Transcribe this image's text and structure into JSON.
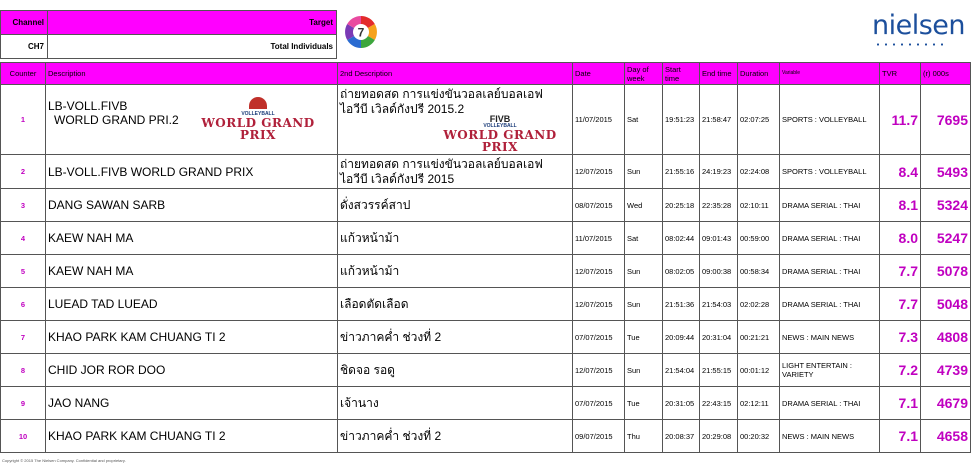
{
  "header": {
    "channel_label": "Channel",
    "target_label": "Target",
    "channel_value": "CH7",
    "target_value": "Total Individuals",
    "brand": "nielsen",
    "channel_logo": "7"
  },
  "columns": {
    "counter": "Counter",
    "description": "Description",
    "description2": "2nd Description",
    "date": "Date",
    "day": "Day of week",
    "start": "Start time",
    "end": "End time",
    "duration": "Duration",
    "variable": "Variable",
    "tvr": "TVR",
    "thousands": "(r) 000s"
  },
  "fivb_logo": {
    "brand": "FIVB",
    "sub": "VOLLEYBALL",
    "title": "WORLD GRAND PRIX"
  },
  "rows": [
    {
      "counter": "1",
      "desc": "LB-VOLL.FIVB",
      "desc_b": "WORLD GRAND PRI.2",
      "desc2": "ถ่ายทอดสด การแข่งขันวอลเลย์บอลเอฟ",
      "desc2_b": "ไอวีบี เวิลด์กังปรี 2015.2",
      "date": "11/07/2015",
      "day": "Sat",
      "start": "19:51:23",
      "end": "21:58:47",
      "duration": "02:07:25",
      "variable": "SPORTS : VOLLEYBALL",
      "tvr": "11.7",
      "thousands": "7695"
    },
    {
      "counter": "2",
      "desc": "LB-VOLL.FIVB WORLD GRAND PRIX",
      "desc_b": "",
      "desc2": "ถ่ายทอดสด การแข่งขันวอลเลย์บอลเอฟ",
      "desc2_b": "ไอวีบี เวิลด์กังปรี 2015",
      "date": "12/07/2015",
      "day": "Sun",
      "start": "21:55:16",
      "end": "24:19:23",
      "duration": "02:24:08",
      "variable": "SPORTS : VOLLEYBALL",
      "tvr": "8.4",
      "thousands": "5493"
    },
    {
      "counter": "3",
      "desc": "DANG SAWAN SARB",
      "desc_b": "",
      "desc2": "ดั่งสวรรค์สาป",
      "desc2_b": "",
      "date": "08/07/2015",
      "day": "Wed",
      "start": "20:25:18",
      "end": "22:35:28",
      "duration": "02:10:11",
      "variable": "DRAMA SERIAL : THAI",
      "tvr": "8.1",
      "thousands": "5324"
    },
    {
      "counter": "4",
      "desc": "KAEW NAH MA",
      "desc_b": "",
      "desc2": "แก้วหน้าม้า",
      "desc2_b": "",
      "date": "11/07/2015",
      "day": "Sat",
      "start": "08:02:44",
      "end": "09:01:43",
      "duration": "00:59:00",
      "variable": "DRAMA SERIAL : THAI",
      "tvr": "8.0",
      "thousands": "5247"
    },
    {
      "counter": "5",
      "desc": "KAEW NAH MA",
      "desc_b": "",
      "desc2": "แก้วหน้าม้า",
      "desc2_b": "",
      "date": "12/07/2015",
      "day": "Sun",
      "start": "08:02:05",
      "end": "09:00:38",
      "duration": "00:58:34",
      "variable": "DRAMA SERIAL : THAI",
      "tvr": "7.7",
      "thousands": "5078"
    },
    {
      "counter": "6",
      "desc": "LUEAD TAD LUEAD",
      "desc_b": "",
      "desc2": "เลือดตัดเลือด",
      "desc2_b": "",
      "date": "12/07/2015",
      "day": "Sun",
      "start": "21:51:36",
      "end": "21:54:03",
      "duration": "02:02:28",
      "variable": "DRAMA SERIAL : THAI",
      "tvr": "7.7",
      "thousands": "5048"
    },
    {
      "counter": "7",
      "desc": "KHAO PARK KAM CHUANG TI 2",
      "desc_b": "",
      "desc2": "ข่าวภาคค่ำ ช่วงที่ 2",
      "desc2_b": "",
      "date": "07/07/2015",
      "day": "Tue",
      "start": "20:09:44",
      "end": "20:31:04",
      "duration": "00:21:21",
      "variable": "NEWS : MAIN NEWS",
      "tvr": "7.3",
      "thousands": "4808"
    },
    {
      "counter": "8",
      "desc": "CHID JOR ROR DOO",
      "desc_b": "",
      "desc2": "ชิดจอ รอดู",
      "desc2_b": "",
      "date": "12/07/2015",
      "day": "Sun",
      "start": "21:54:04",
      "end": "21:55:15",
      "duration": "00:01:12",
      "variable": "LIGHT ENTERTAIN : VARIETY",
      "tvr": "7.2",
      "thousands": "4739"
    },
    {
      "counter": "9",
      "desc": "JAO NANG",
      "desc_b": "",
      "desc2": "เจ้านาง",
      "desc2_b": "",
      "date": "07/07/2015",
      "day": "Tue",
      "start": "20:31:05",
      "end": "22:43:15",
      "duration": "02:12:11",
      "variable": "DRAMA SERIAL : THAI",
      "tvr": "7.1",
      "thousands": "4679"
    },
    {
      "counter": "10",
      "desc": "KHAO PARK KAM CHUANG TI 2",
      "desc_b": "",
      "desc2": "ข่าวภาคค่ำ ช่วงที่ 2",
      "desc2_b": "",
      "date": "09/07/2015",
      "day": "Thu",
      "start": "20:08:37",
      "end": "20:29:08",
      "duration": "00:20:32",
      "variable": "NEWS : MAIN NEWS",
      "tvr": "7.1",
      "thousands": "4658"
    }
  ],
  "footer": "Copyright © 2015 The Nielsen Company. Confidential and proprietary.",
  "colors": {
    "header_bg": "#ff00ff",
    "accent_text": "#c000c0",
    "brand_blue": "#1c4f9c"
  }
}
